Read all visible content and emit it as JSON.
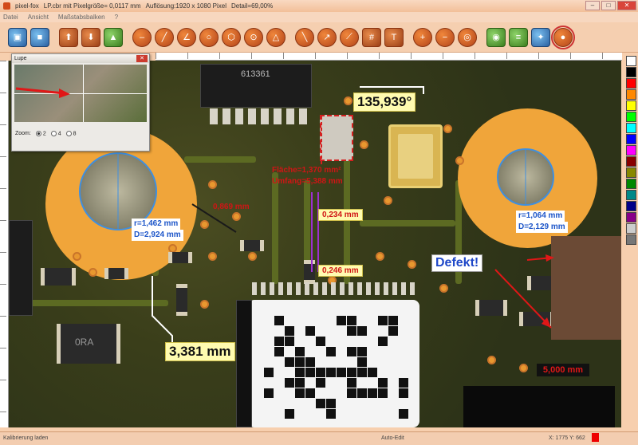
{
  "window": {
    "app_name": "pixel-fox",
    "file": "LP.cbr mit Pixelgröße= 0,0117 mm",
    "resolution": "Auflösung:1920 x 1080 Pixel",
    "detail": "Detail=69,00%",
    "minimize": "–",
    "maximize": "□",
    "close": "✕"
  },
  "menu": [
    "Datei",
    "Ansicht",
    "Maßstabsbalken",
    "?"
  ],
  "toolbar_icons": [
    "open-icon",
    "save-icon",
    "import-icon",
    "export-icon",
    "calibrate-icon",
    "measure-line-icon",
    "measure-polyline-icon",
    "measure-angle-icon",
    "measure-circle-icon",
    "measure-area-icon",
    "count-icon",
    "ruler-icon",
    "pen-icon",
    "arrow-icon",
    "grid-icon",
    "text-icon",
    "zoom-in-icon",
    "zoom-out-icon",
    "zoom-fit-icon",
    "camera-icon",
    "layers-icon",
    "settings-icon",
    "magnifier-icon"
  ],
  "magnifier": {
    "title": "Lupe",
    "close": "✕",
    "zoom_label": "Zoom:",
    "options": [
      "2",
      "4",
      "8"
    ],
    "selected": "2"
  },
  "annotations": {
    "angle": "135,939°",
    "area": "Fläche=1,370 mm²",
    "perimeter": "Umfang=5,388 mm",
    "dist1": "0,869 mm",
    "dist2": "0,234 mm",
    "dist3": "0,246 mm",
    "dist4": "3,381 mm",
    "circle_left_r": "r=1,462 mm",
    "circle_left_d": "D=2,924 mm",
    "circle_right_r": "r=1,064 mm",
    "circle_right_d": "D=2,129 mm",
    "defect": "Defekt!",
    "scalebar": "5,000 mm",
    "chip_text": "613361",
    "smd_text": "0RA"
  },
  "palette_colors": [
    "#ffffff",
    "#000000",
    "#ff0000",
    "#ff8800",
    "#ffff00",
    "#00ff00",
    "#00ffff",
    "#0000ff",
    "#ff00ff",
    "#880000",
    "#888800",
    "#008800",
    "#008888",
    "#000088",
    "#880088",
    "#cccccc",
    "#777777"
  ],
  "status": {
    "left": "Kalibrierung laden",
    "mode": "Auto-Edit",
    "coords": "X: 1775  Y: 662"
  }
}
